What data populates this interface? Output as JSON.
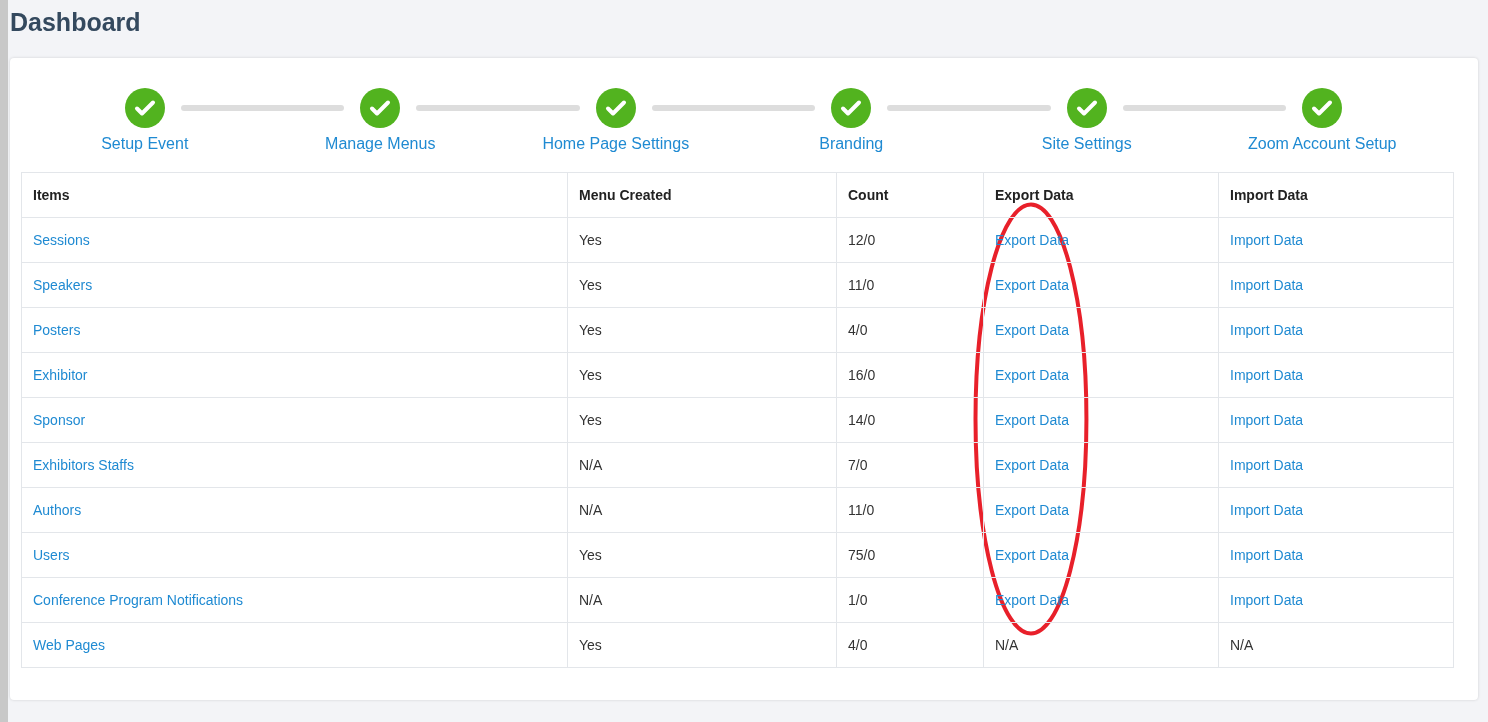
{
  "page_title": "Dashboard",
  "steps": [
    {
      "label": "Setup Event",
      "done": true
    },
    {
      "label": "Manage Menus",
      "done": true
    },
    {
      "label": "Home Page Settings",
      "done": true
    },
    {
      "label": "Branding",
      "done": true
    },
    {
      "label": "Site Settings",
      "done": true
    },
    {
      "label": "Zoom Account Setup",
      "done": true
    }
  ],
  "table": {
    "columns": [
      "Items",
      "Menu Created",
      "Count",
      "Export Data",
      "Import Data"
    ],
    "rows": [
      {
        "cells": [
          {
            "text": "Sessions",
            "kind": "link"
          },
          {
            "text": "Yes",
            "kind": "text"
          },
          {
            "text": "12/0",
            "kind": "text"
          },
          {
            "text": "Export Data",
            "kind": "link"
          },
          {
            "text": "Import Data",
            "kind": "link"
          }
        ]
      },
      {
        "cells": [
          {
            "text": "Speakers",
            "kind": "link"
          },
          {
            "text": "Yes",
            "kind": "text"
          },
          {
            "text": "11/0",
            "kind": "text"
          },
          {
            "text": "Export Data",
            "kind": "link"
          },
          {
            "text": "Import Data",
            "kind": "link"
          }
        ]
      },
      {
        "cells": [
          {
            "text": "Posters",
            "kind": "link"
          },
          {
            "text": "Yes",
            "kind": "text"
          },
          {
            "text": "4/0",
            "kind": "text"
          },
          {
            "text": "Export Data",
            "kind": "link"
          },
          {
            "text": "Import Data",
            "kind": "link"
          }
        ]
      },
      {
        "cells": [
          {
            "text": "Exhibitor",
            "kind": "link"
          },
          {
            "text": "Yes",
            "kind": "text"
          },
          {
            "text": "16/0",
            "kind": "text"
          },
          {
            "text": "Export Data",
            "kind": "link"
          },
          {
            "text": "Import Data",
            "kind": "link"
          }
        ]
      },
      {
        "cells": [
          {
            "text": "Sponsor",
            "kind": "link"
          },
          {
            "text": "Yes",
            "kind": "text"
          },
          {
            "text": "14/0",
            "kind": "text"
          },
          {
            "text": "Export Data",
            "kind": "link"
          },
          {
            "text": "Import Data",
            "kind": "link"
          }
        ]
      },
      {
        "cells": [
          {
            "text": "Exhibitors Staffs",
            "kind": "link"
          },
          {
            "text": "N/A",
            "kind": "text"
          },
          {
            "text": "7/0",
            "kind": "text"
          },
          {
            "text": "Export Data",
            "kind": "link"
          },
          {
            "text": "Import Data",
            "kind": "link"
          }
        ]
      },
      {
        "cells": [
          {
            "text": "Authors",
            "kind": "link"
          },
          {
            "text": "N/A",
            "kind": "text"
          },
          {
            "text": "11/0",
            "kind": "text"
          },
          {
            "text": "Export Data",
            "kind": "link"
          },
          {
            "text": "Import Data",
            "kind": "link"
          }
        ]
      },
      {
        "cells": [
          {
            "text": "Users",
            "kind": "link"
          },
          {
            "text": "Yes",
            "kind": "text"
          },
          {
            "text": "75/0",
            "kind": "text"
          },
          {
            "text": "Export Data",
            "kind": "link"
          },
          {
            "text": "Import Data",
            "kind": "link"
          }
        ]
      },
      {
        "cells": [
          {
            "text": "Conference Program Notifications",
            "kind": "link"
          },
          {
            "text": "N/A",
            "kind": "text"
          },
          {
            "text": "1/0",
            "kind": "text"
          },
          {
            "text": "Export Data",
            "kind": "link"
          },
          {
            "text": "Import Data",
            "kind": "link"
          }
        ]
      },
      {
        "cells": [
          {
            "text": "Web Pages",
            "kind": "link"
          },
          {
            "text": "Yes",
            "kind": "text"
          },
          {
            "text": "4/0",
            "kind": "text"
          },
          {
            "text": "N/A",
            "kind": "text"
          },
          {
            "text": "N/A",
            "kind": "text"
          }
        ]
      }
    ]
  },
  "annotation": {
    "kind": "ellipse",
    "color": "#e8202a"
  }
}
